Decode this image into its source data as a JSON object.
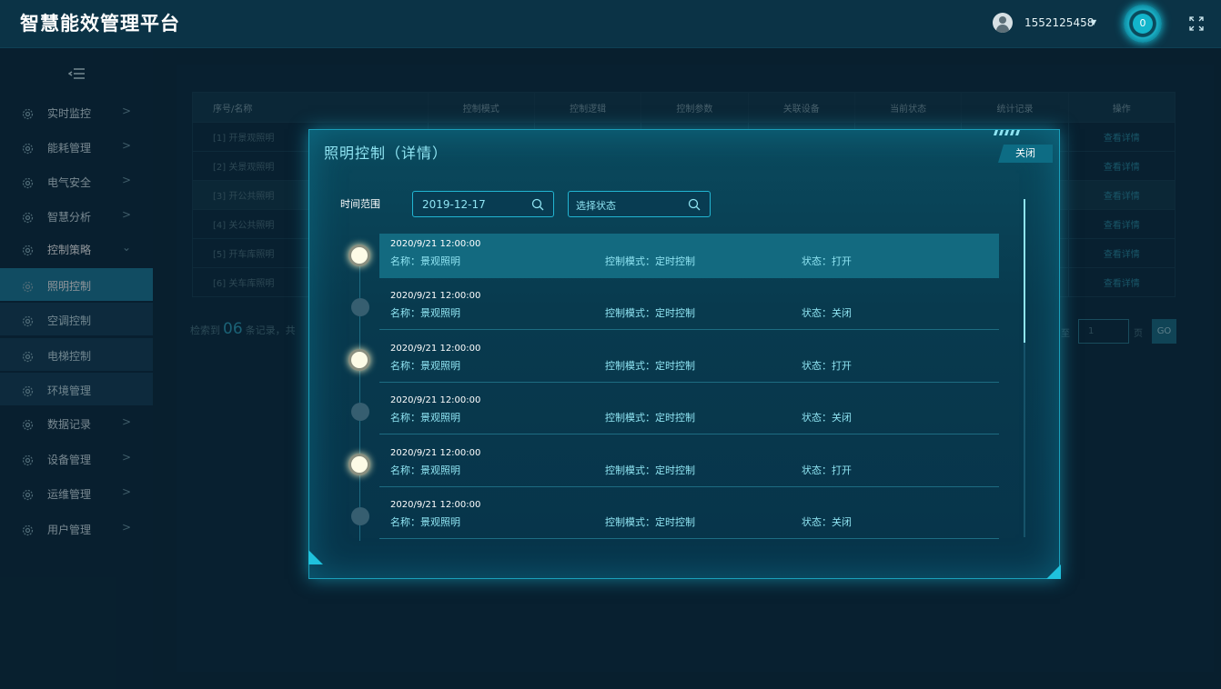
{
  "header": {
    "app_title": "智慧能效管理平台",
    "username": "1552125458",
    "notification_count": "0"
  },
  "sidebar": {
    "items": [
      {
        "label": "实时监控",
        "chevron": ">"
      },
      {
        "label": "能耗管理",
        "chevron": ">"
      },
      {
        "label": "电气安全",
        "chevron": ">"
      },
      {
        "label": "智慧分析",
        "chevron": ">"
      },
      {
        "label": "控制策略",
        "chevron": "⌄"
      },
      {
        "label": "数据记录",
        "chevron": ">"
      },
      {
        "label": "设备管理",
        "chevron": ">"
      },
      {
        "label": "运维管理",
        "chevron": ">"
      },
      {
        "label": "用户管理",
        "chevron": ">"
      }
    ],
    "sub_items": [
      {
        "label": "照明控制",
        "active": true
      },
      {
        "label": "空调控制",
        "active": false
      },
      {
        "label": "电梯控制",
        "active": false
      },
      {
        "label": "环境管理",
        "active": false
      }
    ]
  },
  "table": {
    "columns": [
      "序号/名称",
      "控制模式",
      "控制逻辑",
      "控制参数",
      "关联设备",
      "当前状态",
      "统计记录",
      "操作"
    ],
    "rows": [
      {
        "name": "[1] 开景观照明",
        "op": "查看详情"
      },
      {
        "name": "[2] 关景观照明",
        "op": "查看详情"
      },
      {
        "name": "[3] 开公共照明",
        "op": "查看详情"
      },
      {
        "name": "[4] 关公共照明",
        "op": "查看详情"
      },
      {
        "name": "[5] 开车库照明",
        "op": "查看详情"
      },
      {
        "name": "[6] 关车库照明",
        "op": "查看详情"
      }
    ],
    "count_prefix": "检索到",
    "count_value": "06",
    "count_suffix": "条记录，共",
    "pager_to": "至",
    "pager_value": "1",
    "pager_page": "页",
    "pager_go": "GO"
  },
  "modal": {
    "title": "照明控制（详情）",
    "close_label": "关闭",
    "filter_label": "时间范围",
    "date_value": "2019-12-17",
    "status_placeholder": "选择状态",
    "records": [
      {
        "time": "2020/9/21 12:00:00",
        "name": "名称：景观照明",
        "mode": "控制模式：定时控制",
        "state": "状态：打开",
        "on": true
      },
      {
        "time": "2020/9/21 12:00:00",
        "name": "名称：景观照明",
        "mode": "控制模式：定时控制",
        "state": "状态：关闭",
        "on": false
      },
      {
        "time": "2020/9/21 12:00:00",
        "name": "名称：景观照明",
        "mode": "控制模式：定时控制",
        "state": "状态：打开",
        "on": true
      },
      {
        "time": "2020/9/21 12:00:00",
        "name": "名称：景观照明",
        "mode": "控制模式：定时控制",
        "state": "状态：关闭",
        "on": false
      },
      {
        "time": "2020/9/21 12:00:00",
        "name": "名称：景观照明",
        "mode": "控制模式：定时控制",
        "state": "状态：打开",
        "on": true
      },
      {
        "time": "2020/9/21 12:00:00",
        "name": "名称：景观照明",
        "mode": "控制模式：定时控制",
        "state": "状态：关闭",
        "on": false
      }
    ]
  },
  "colors": {
    "accent": "#22b5d2",
    "active_menu": "#1d7d9b",
    "background": "#0c2a3d"
  },
  "icons": {
    "user": "user-icon",
    "fullscreen": "fullscreen-icon",
    "menu_toggle": "menu-toggle-icon",
    "menu": "gear-icon",
    "search": "search-icon"
  }
}
